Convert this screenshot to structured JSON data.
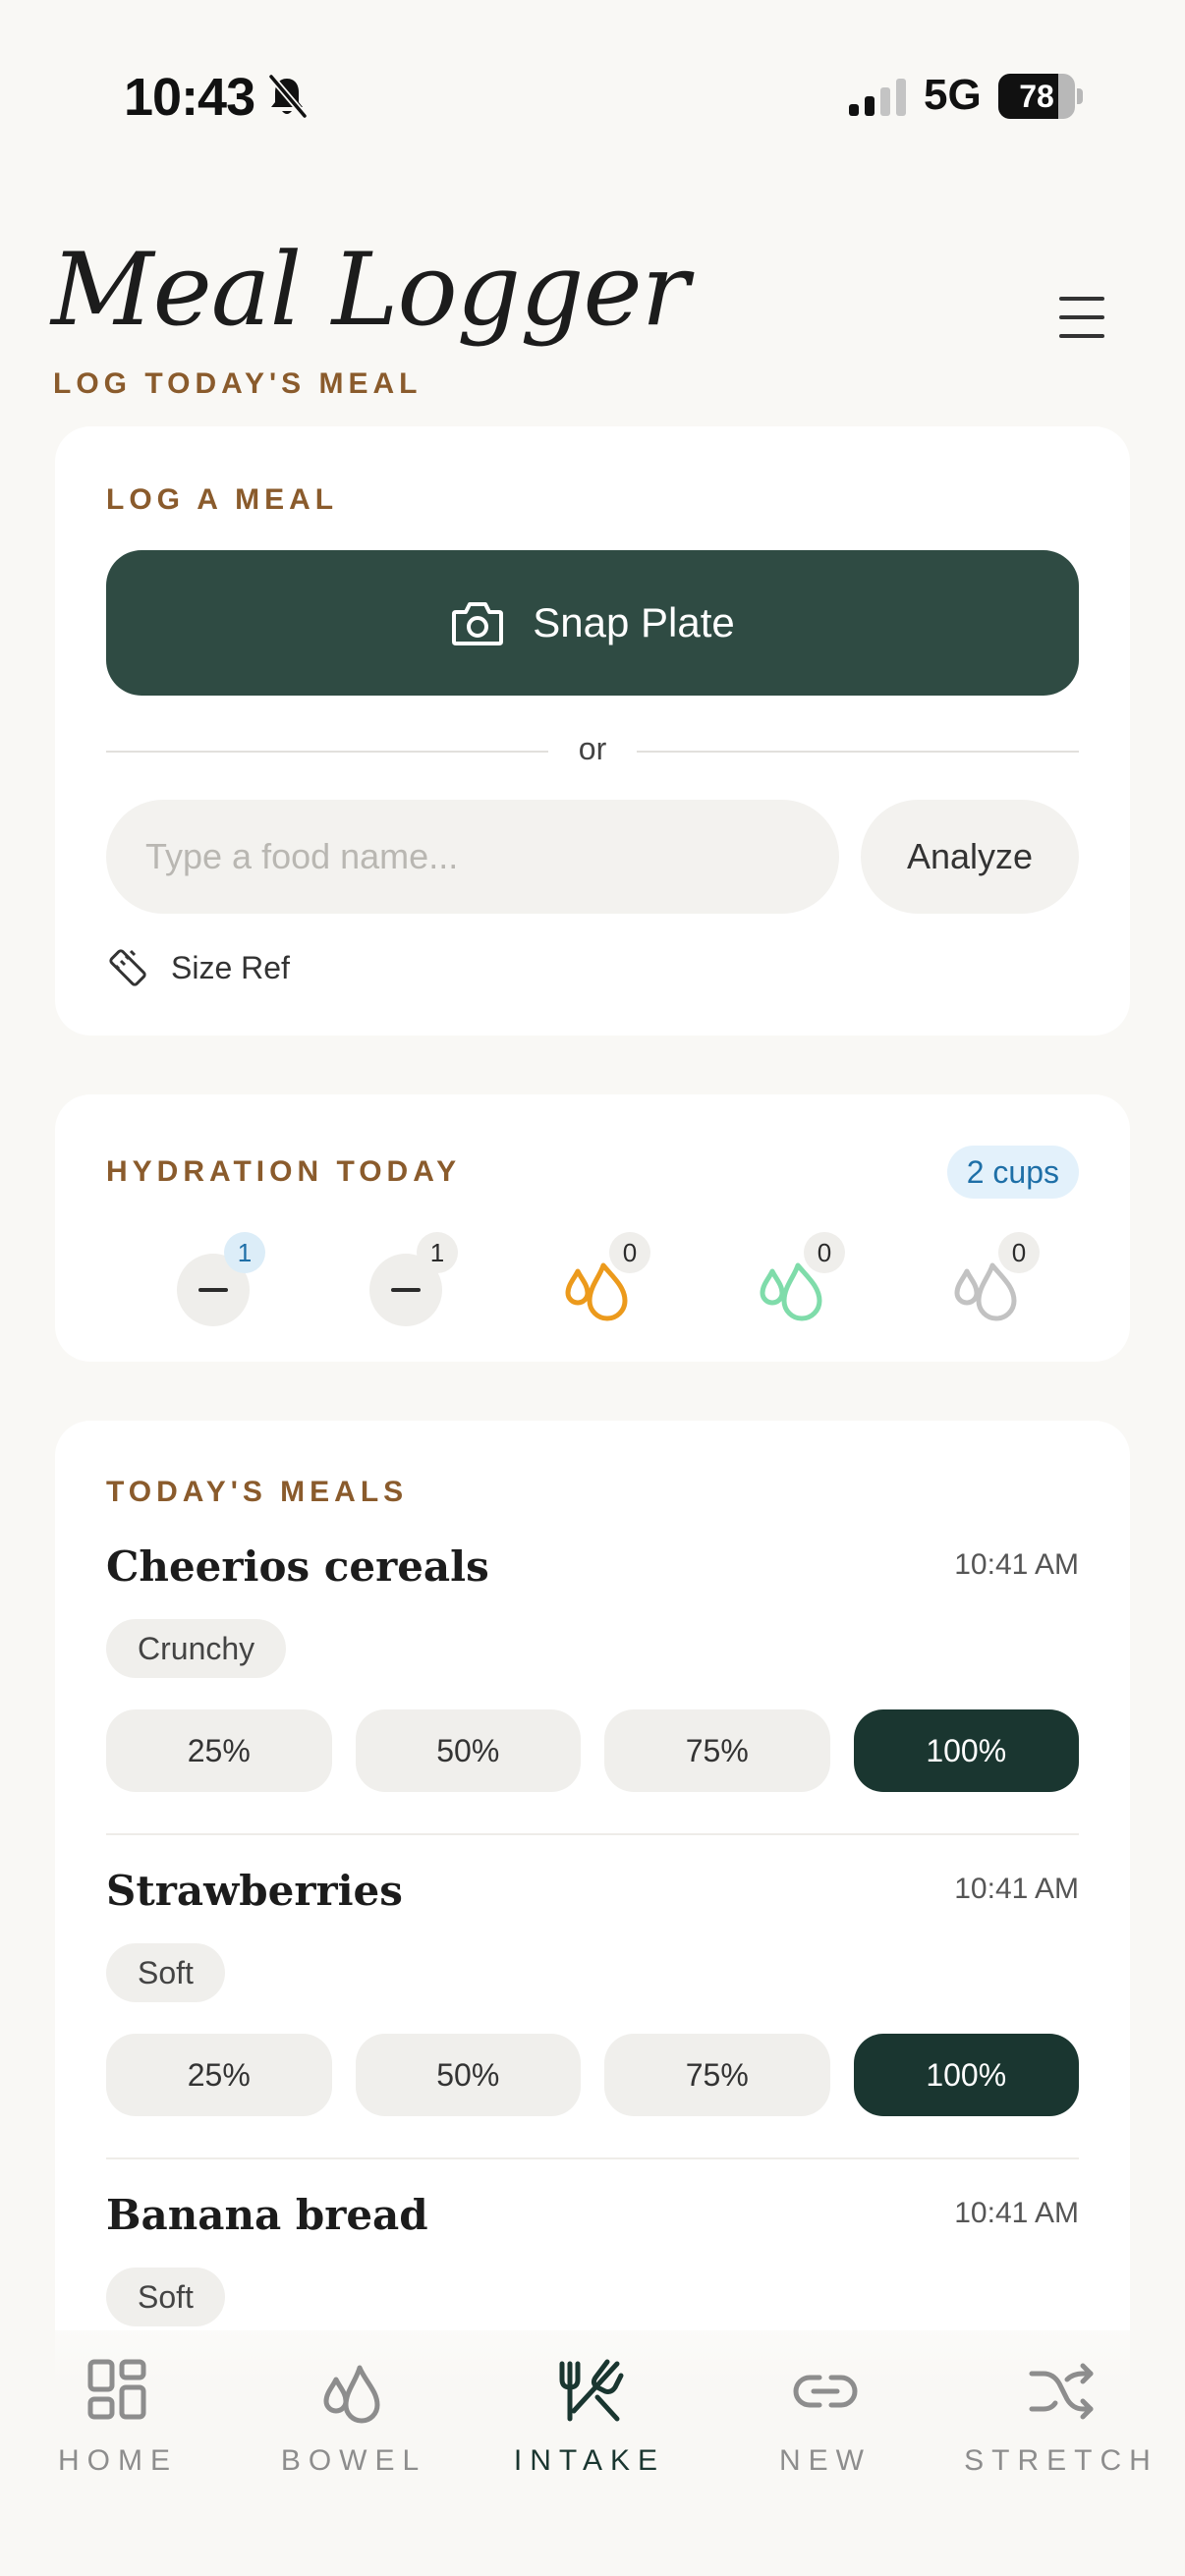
{
  "status_bar": {
    "time": "10:43",
    "network": "5G",
    "battery": "78",
    "battery_level": 0.78
  },
  "header": {
    "title": "Meal Logger",
    "subtitle": "LOG TODAY'S MEAL"
  },
  "log_meal": {
    "section_label": "LOG A MEAL",
    "snap_button_label": "Snap Plate",
    "divider_text": "or",
    "food_input_placeholder": "Type a food name...",
    "food_input_value": "",
    "analyze_label": "Analyze",
    "size_ref_label": "Size Ref"
  },
  "hydration": {
    "section_label": "HYDRATION TODAY",
    "total_badge": "2 cups",
    "drinks": [
      {
        "icon": "minus-icon",
        "count": "1",
        "active": true
      },
      {
        "icon": "minus-icon",
        "count": "1",
        "active": false
      },
      {
        "icon": "droplets-icon",
        "color": "#ec9a1c",
        "count": "0"
      },
      {
        "icon": "droplets-icon",
        "color": "#7fdcaa",
        "count": "0"
      },
      {
        "icon": "droplets-icon",
        "color": "#c2c2c2",
        "count": "0"
      }
    ]
  },
  "meals": {
    "section_label": "TODAY'S MEALS",
    "items": [
      {
        "name": "Cheerios cereals",
        "time": "10:41 AM",
        "tag": "Crunchy",
        "portions": [
          "25%",
          "50%",
          "75%",
          "100%"
        ],
        "selected_portion": "100%"
      },
      {
        "name": "Strawberries",
        "time": "10:41 AM",
        "tag": "Soft",
        "portions": [
          "25%",
          "50%",
          "75%",
          "100%"
        ],
        "selected_portion": "100%"
      },
      {
        "name": "Banana bread",
        "time": "10:41 AM",
        "tag": "Soft"
      }
    ]
  },
  "nav": {
    "items": [
      {
        "label": "HOME",
        "icon": "grid-icon",
        "active": false
      },
      {
        "label": "BOWEL",
        "icon": "droplets-icon",
        "active": false
      },
      {
        "label": "INTAKE",
        "icon": "utensils-icon",
        "active": true
      },
      {
        "label": "NEW",
        "icon": "link-icon",
        "active": false
      },
      {
        "label": "STRETCH",
        "icon": "shuffle-icon",
        "active": false
      }
    ]
  },
  "colors": {
    "accent_dark": "#2f4b43",
    "selected_portion": "#1a3630",
    "label_brown": "#8a5b2c",
    "badge_blue": "#1e6fa7"
  }
}
